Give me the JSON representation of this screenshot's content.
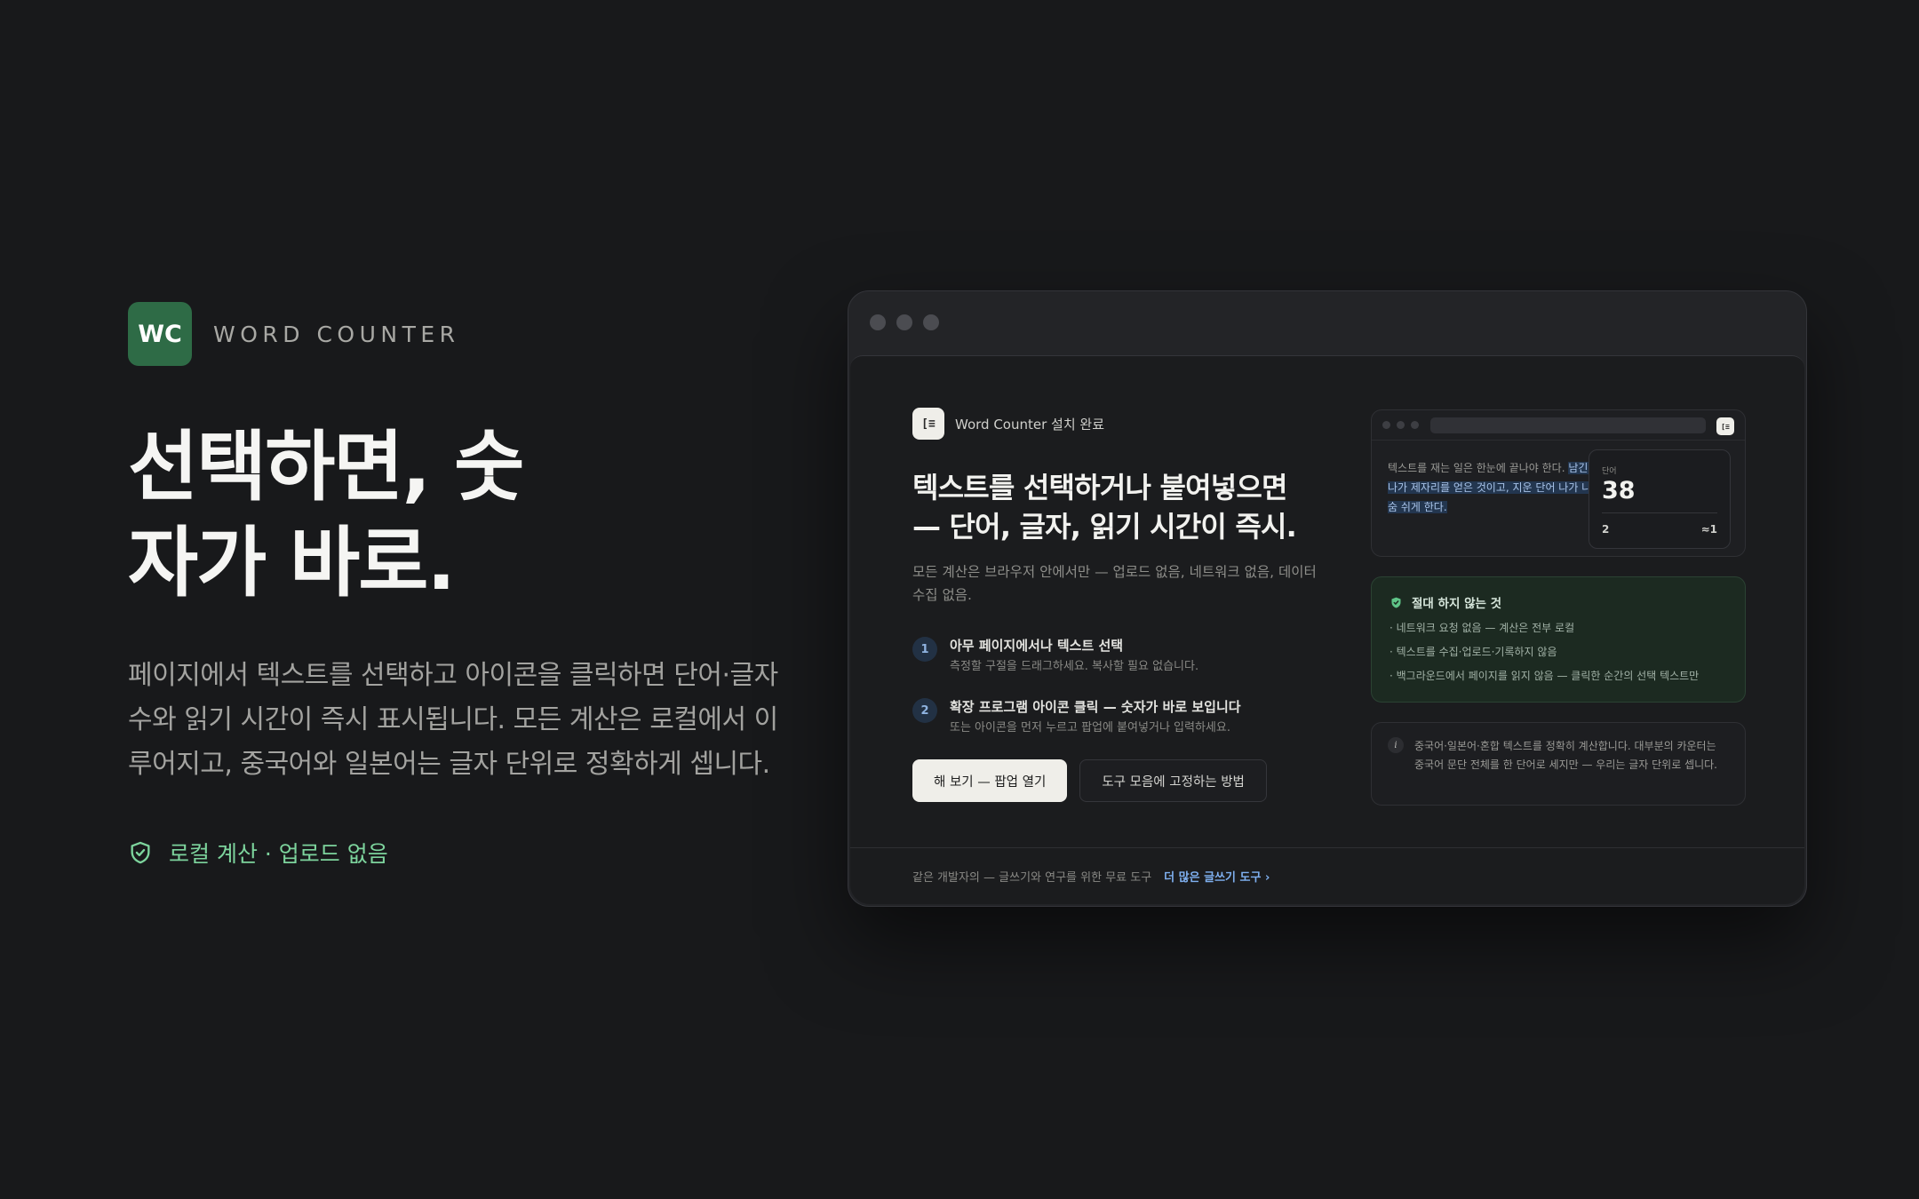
{
  "brand": {
    "logo_text": "WC",
    "name": "WORD COUNTER",
    "logo_color": "#2e6b46"
  },
  "hero": {
    "headline_line1": "선택하면, 숫",
    "headline_line2": "자가 바로.",
    "lead": "페이지에서 텍스트를 선택하고 아이콘을 클릭하면 단어·글자 수와 읽기 시간이 즉시 표시됩니다. 모든 계산은 로컬에서 이루어지고, 중국어와 일본어는 글자 단위로 정확하게 셉니다.",
    "trust_icon": "shield-check-icon",
    "trust_text": "로컬 계산 · 업로드 없음",
    "trust_color": "#7dd49d"
  },
  "popup": {
    "installed_icon_text": "[≡",
    "installed_label": "Word Counter 설치 완료",
    "title": "텍스트를 선택하거나 붙여넣으면 — 단어, 글자, 읽기 시간이 즉시.",
    "subtitle": "모든 계산은 브라우저 안에서만 — 업로드 없음, 네트워크 없음, 데이터 수집 없음.",
    "steps": [
      {
        "num": "1",
        "title": "아무 페이지에서나 텍스트 선택",
        "desc": "측정할 구절을 드래그하세요. 복사할 필요 없습니다."
      },
      {
        "num": "2",
        "title": "확장 프로그램 아이콘 클릭 — 숫자가 바로 보입니다",
        "desc": "또는 아이콘을 먼저 누르고 팝업에 붙여넣거나 입력하세요."
      }
    ],
    "primary_button": "해 보기 — 팝업 열기",
    "secondary_button": "도구 모음에 고정하는 방법",
    "footer_text": "같은 개발자의 — 글쓰기와 연구를 위한 무료 도구",
    "footer_link": "더 많은 글쓰기 도구 ›",
    "mini": {
      "ext_icon_text": "[≡",
      "text_plain": "텍스트를 재는 일은 한눈에 끝나야 한다. ",
      "text_highlight": "남긴 하나하나가 제자리를 얻은 것이고, 지운 단어 나가 나머지를 숨 쉬게 한다.",
      "count_label": "단어",
      "count_value": "38",
      "count_a": "2",
      "count_b": "≈1"
    },
    "never": {
      "icon": "shield-check-icon",
      "title": "절대 하지 않는 것",
      "items": [
        "· 네트워크 요청 없음 — 계산은 전부 로컬",
        "· 텍스트를 수집·업로드·기록하지 않음",
        "· 백그라운드에서 페이지를 읽지 않음 — 클릭한 순간의 선택 텍스트만"
      ]
    },
    "note": {
      "icon": "info-icon",
      "text": "중국어·일본어·혼합 텍스트를 정확히 계산합니다. 대부분의 카운터는 중국어 문단 전체를 한 단어로 세지만 — 우리는 글자 단위로 셉니다."
    }
  }
}
